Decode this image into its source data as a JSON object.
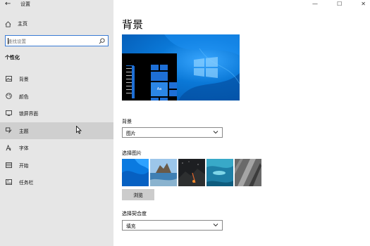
{
  "window": {
    "title": "设置",
    "back_glyph": "←",
    "controls": {
      "minimize": "—",
      "maximize": "☐",
      "close": "✕"
    }
  },
  "sidebar": {
    "home_label": "主页",
    "search_placeholder": "查找设置",
    "section_label": "个性化",
    "items": [
      {
        "label": "背景",
        "icon": "picture-icon"
      },
      {
        "label": "颜色",
        "icon": "palette-icon"
      },
      {
        "label": "锁屏界面",
        "icon": "lock-screen-icon"
      },
      {
        "label": "主题",
        "icon": "brush-icon"
      },
      {
        "label": "字体",
        "icon": "font-icon"
      },
      {
        "label": "开始",
        "icon": "start-icon"
      },
      {
        "label": "任务栏",
        "icon": "taskbar-icon"
      }
    ]
  },
  "main": {
    "title": "背景",
    "preview_tile_label": "Aa",
    "background_label": "背景",
    "background_value": "图片",
    "choose_picture_label": "选择图片",
    "browse_label": "浏览",
    "fit_label": "选择契合度",
    "fit_value": "填充"
  },
  "colors": {
    "accent": "#0078d7",
    "sidebar_bg": "#e6e6e6",
    "hover_bg": "#cfcfcf"
  }
}
